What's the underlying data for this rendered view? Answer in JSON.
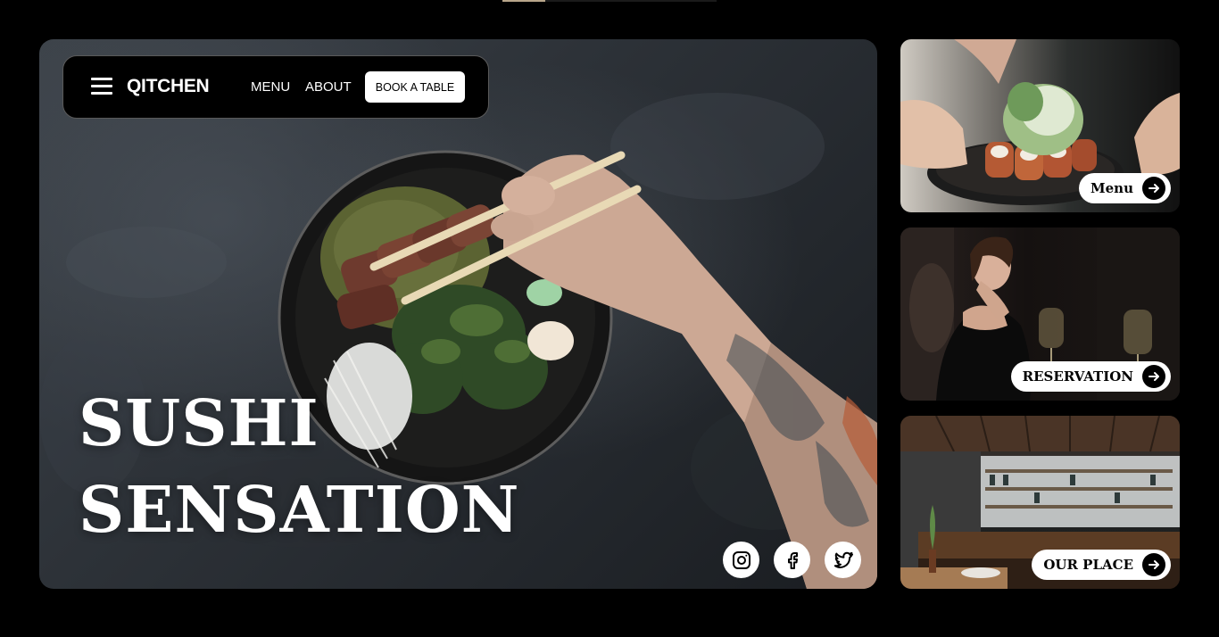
{
  "brand": {
    "name": "QITCHEN"
  },
  "loader": {
    "progress": 0.2
  },
  "nav": {
    "items": [
      {
        "label": "MENU"
      },
      {
        "label": "ABOUT"
      }
    ],
    "cta": "BOOK A TABLE"
  },
  "hero": {
    "title_line1": "SUSHI",
    "title_line2": "SENSATION"
  },
  "social": [
    {
      "icon": "instagram-icon"
    },
    {
      "icon": "facebook-icon"
    },
    {
      "icon": "twitter-icon"
    }
  ],
  "cards": [
    {
      "label": "Menu",
      "icon": "arrow-right-icon"
    },
    {
      "label": "RESERVATION",
      "icon": "arrow-right-icon"
    },
    {
      "label": "OUR PLACE",
      "icon": "arrow-right-icon"
    }
  ]
}
